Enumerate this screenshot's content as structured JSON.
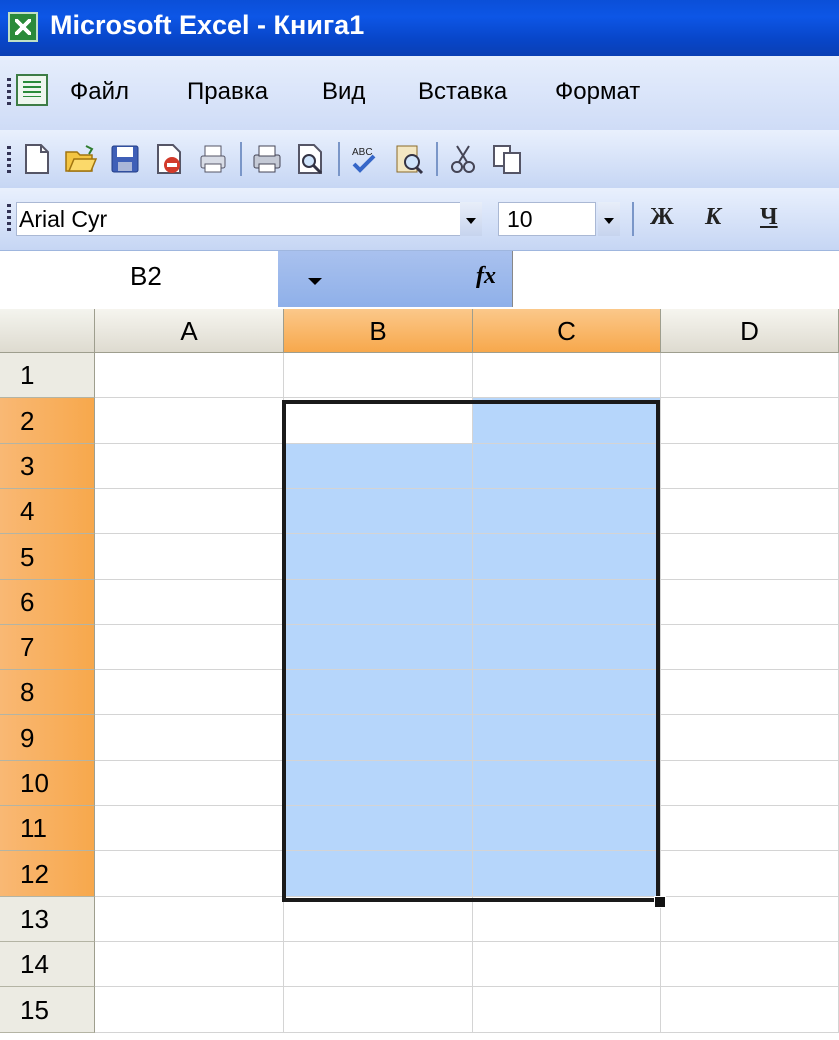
{
  "window": {
    "title": "Microsoft Excel - Книга1"
  },
  "menu": {
    "items": [
      {
        "label": "Файл"
      },
      {
        "label": "Правка"
      },
      {
        "label": "Вид"
      },
      {
        "label": "Вставка"
      },
      {
        "label": "Формат"
      }
    ]
  },
  "toolbar": {
    "icons": [
      "new-document-icon",
      "open-folder-icon",
      "save-icon",
      "permission-icon",
      "print-area-icon",
      "print-icon",
      "print-preview-icon",
      "spelling-icon",
      "research-icon",
      "cut-icon",
      "copy-icon"
    ]
  },
  "format_bar": {
    "font_name": "Arial Cyr",
    "font_size": "10",
    "bold_label": "Ж",
    "italic_label": "К",
    "underline_label": "Ч"
  },
  "formula_bar": {
    "name_box": "B2",
    "fx_label": "fx",
    "formula": ""
  },
  "sheet": {
    "columns": [
      "A",
      "B",
      "C",
      "D"
    ],
    "rows": [
      "1",
      "2",
      "3",
      "4",
      "5",
      "6",
      "7",
      "8",
      "9",
      "10",
      "11",
      "12",
      "13",
      "14",
      "15"
    ],
    "active_cell": "B2",
    "selection": "B2:C12",
    "colors": {
      "selection_fill": "#b6d6fb",
      "header_highlight": "#f7a84c",
      "titlebar": "#0b4fd8"
    }
  }
}
